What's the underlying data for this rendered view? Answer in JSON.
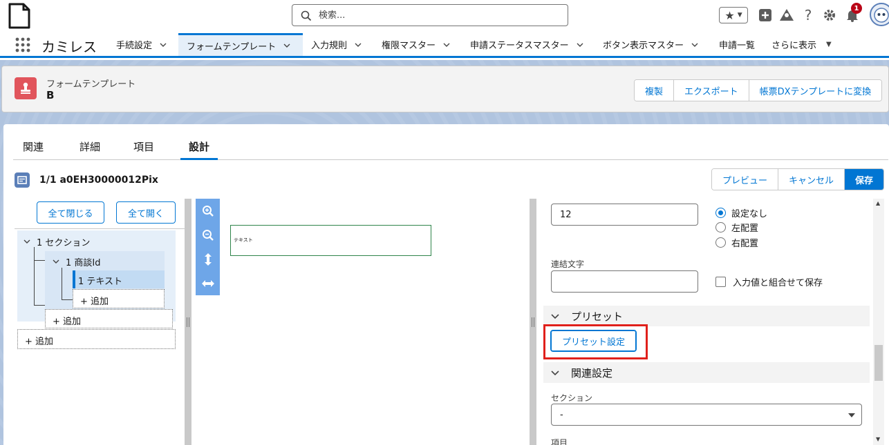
{
  "header": {
    "search_placeholder": "検索...",
    "notification_count": "1"
  },
  "nav": {
    "app_name": "カミレス",
    "tabs": [
      {
        "label": "手続設定"
      },
      {
        "label": "フォームテンプレート"
      },
      {
        "label": "入力規則"
      },
      {
        "label": "権限マスター"
      },
      {
        "label": "申請ステータスマスター"
      },
      {
        "label": "ボタン表示マスター"
      },
      {
        "label": "申請一覧"
      },
      {
        "label": "さらに表示"
      }
    ]
  },
  "record": {
    "type_label": "フォームテンプレート",
    "name": "B",
    "actions": [
      "複製",
      "エクスポート",
      "帳票DXテンプレートに変換"
    ]
  },
  "tabs": [
    "関連",
    "詳細",
    "項目",
    "設計"
  ],
  "design": {
    "title": "1/1 a0EH30000012Pix",
    "actions": {
      "preview": "プレビュー",
      "cancel": "キャンセル",
      "save": "保存"
    },
    "tree": {
      "collapse_all": "全て閉じる",
      "expand_all": "全て開く",
      "section": "1 セクション",
      "group": "1 商談Id",
      "item": "1 テキスト",
      "add1": "+ 追加",
      "add2": "+ 追加",
      "add3": "+ 追加"
    },
    "canvas": {
      "field_text": "テキスト"
    },
    "props": {
      "input_value": "12",
      "radio_options": [
        "設定なし",
        "左配置",
        "右配置"
      ],
      "selected_radio": "設定なし",
      "concat_label": "連結文字",
      "concat_value": "",
      "save_combined_label": "入力値と組合せて保存",
      "preset_section": "プリセット",
      "preset_button": "プリセット設定",
      "related_section": "関連設定",
      "section_label": "セクション",
      "section_value": "-",
      "item_label": "項目"
    }
  },
  "colors": {
    "brand": "#0176d3",
    "record_icon": "#e1555c",
    "highlight": "#e0201b",
    "field_border": "#2e844a"
  }
}
